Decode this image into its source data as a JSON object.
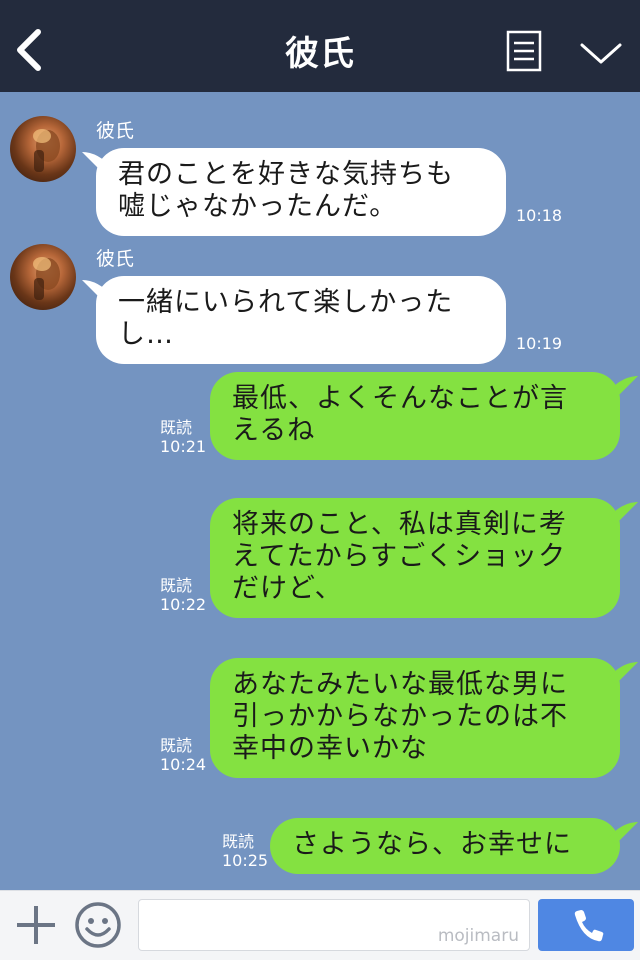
{
  "header": {
    "title": "彼氏"
  },
  "messages": [
    {
      "direction": "in",
      "sender": "彼氏",
      "lines": [
        "君のことを好きな気持ちも",
        "嘘じゃなかったんだ。"
      ],
      "time": "10:18"
    },
    {
      "direction": "in",
      "sender": "彼氏",
      "lines": [
        "一緒にいられて楽しかった",
        "し…"
      ],
      "time": "10:19"
    },
    {
      "direction": "out",
      "read": "既読",
      "lines": [
        "最低、よくそんなことが言",
        "えるね"
      ],
      "time": "10:21"
    },
    {
      "direction": "out",
      "read": "既読",
      "lines": [
        "将来のこと、私は真剣に考",
        "えてたからすごくショック",
        "だけど、"
      ],
      "time": "10:22"
    },
    {
      "direction": "out",
      "read": "既読",
      "lines": [
        "あなたみたいな最低な男に",
        "引っかからなかったのは不",
        "幸中の幸いかな"
      ],
      "time": "10:24"
    },
    {
      "direction": "out",
      "read": "既読",
      "lines": [
        "さようなら、お幸せに"
      ],
      "time": "10:25"
    }
  ],
  "footer": {
    "input_value": "",
    "watermark": "mojimaru"
  },
  "colors": {
    "header_bg": "#232b3d",
    "chat_bg": "#7494c1",
    "incoming_bubble": "#ffffff",
    "outgoing_bubble": "#84e141",
    "send_button": "#4f87e3"
  },
  "icons": {
    "back": "chevron-left-icon",
    "menu": "list-icon",
    "collapse": "chevron-down-icon",
    "add": "plus-icon",
    "emoji": "smiley-icon",
    "call": "phone-icon"
  }
}
